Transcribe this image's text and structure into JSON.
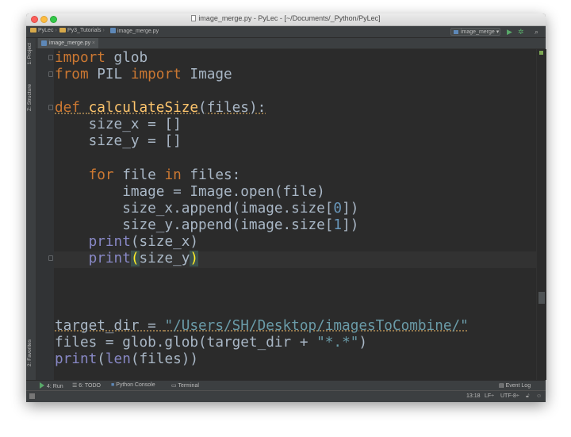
{
  "window": {
    "title": "image_merge.py - PyLec - [~/Documents/_Python/PyLec]"
  },
  "navbar": {
    "crumbs": [
      "PyLec",
      "Py3_Tutorials",
      "image_merge.py"
    ],
    "run_config": "image_merge",
    "run_icon": "play-icon",
    "debug_icon": "bug-icon",
    "search_icon": "search-icon"
  },
  "left_tools": {
    "project_label": "1: Project",
    "structure_label": "Z: Structure",
    "favorites_label": "2: Favorites"
  },
  "editor": {
    "active_tab": "image_merge.py",
    "lines": [
      "import glob",
      "from PIL import Image",
      "",
      "def calculateSize(files):",
      "    size_x = []",
      "    size_y = []",
      "",
      "    for file in files:",
      "        image = Image.open(file)",
      "        size_x.append(image.size[0])",
      "        size_y.append(image.size[1])",
      "    print(size_x)",
      "    print(size_y)",
      "",
      "",
      "",
      "target_dir = \"/Users/SH/Desktop/imagesToCombine/\"",
      "files = glob.glob(target_dir + \"*.*\")",
      "print(len(files))"
    ]
  },
  "bottom_tools": {
    "run": "4: Run",
    "todo": "6: TODO",
    "python_console": "Python Console",
    "terminal": "Terminal",
    "event_log": "Event Log"
  },
  "status": {
    "position": "13:18",
    "line_separator": "LF÷",
    "encoding": "UTF-8÷"
  },
  "colors": {
    "keyword": "#cc7832",
    "function": "#ffc66d",
    "builtin": "#8888c6",
    "number": "#6897bb",
    "string": "#6a9ba8",
    "background": "#2b2b2b"
  }
}
